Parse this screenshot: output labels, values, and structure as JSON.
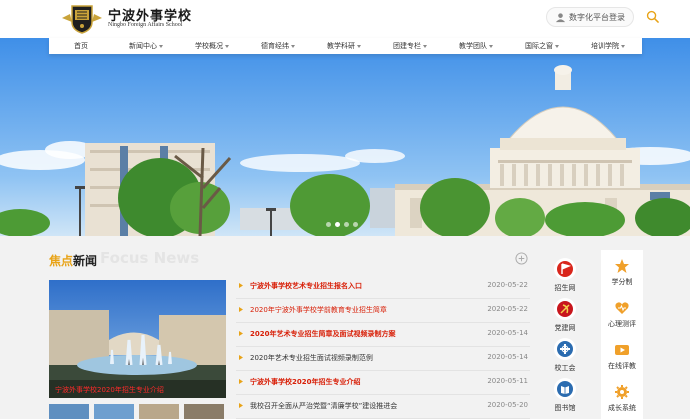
{
  "header": {
    "school_name_cn": "宁波外事学校",
    "school_name_en": "Ningbo Foreign Affairs School",
    "portal_label": "数字化平台登录"
  },
  "nav": {
    "items": [
      {
        "label": "首页",
        "dropdown": false
      },
      {
        "label": "新闻中心",
        "dropdown": true
      },
      {
        "label": "学校概况",
        "dropdown": true
      },
      {
        "label": "德育经纬",
        "dropdown": true
      },
      {
        "label": "教学科研",
        "dropdown": true
      },
      {
        "label": "团建专栏",
        "dropdown": true
      },
      {
        "label": "教学团队",
        "dropdown": true
      },
      {
        "label": "国际之窗",
        "dropdown": true
      },
      {
        "label": "培训学院",
        "dropdown": true
      }
    ]
  },
  "banner": {
    "active_slide": 1,
    "slide_count": 4
  },
  "news": {
    "title_highlight": "焦点",
    "title_rest": "新闻",
    "title_en": "Focus News",
    "feature_caption": "宁波外事学校2020年招生专业介绍",
    "items": [
      {
        "title": "宁波外事学校艺术专业招生报名入口",
        "date": "2020-05-22",
        "color": "#d81e06",
        "bold": true
      },
      {
        "title": "2020年宁波外事学校学前教育专业招生简章",
        "date": "2020-05-22",
        "color": "#d81e06",
        "bold": false
      },
      {
        "title": "2020年艺术专业招生简章及面试视频录制方案",
        "date": "2020-05-14",
        "color": "#d81e06",
        "bold": true
      },
      {
        "title": "2020年艺术专业招生面试视频录制范例",
        "date": "2020-05-14",
        "color": "#333333",
        "bold": false
      },
      {
        "title": "宁波外事学校2020年招生专业介绍",
        "date": "2020-05-11",
        "color": "#d81e06",
        "bold": true
      },
      {
        "title": "我校召开全面从严治党暨“清廉学校”建设推进会",
        "date": "2020-05-20",
        "color": "#333333",
        "bold": false
      }
    ]
  },
  "side_links": [
    {
      "label": "招生网",
      "icon": "flag-icon",
      "color": "#d9261c"
    },
    {
      "label": "党建网",
      "icon": "party-emblem-icon",
      "color": "#c8161d"
    },
    {
      "label": "校工会",
      "icon": "union-icon",
      "color": "#2b6cb0"
    },
    {
      "label": "图书馆",
      "icon": "library-icon",
      "color": "#2b6cb0"
    }
  ],
  "cards": [
    {
      "label": "学分制",
      "icon": "star-icon"
    },
    {
      "label": "心理测评",
      "icon": "heart-icon"
    },
    {
      "label": "在线评教",
      "icon": "video-icon"
    },
    {
      "label": "成长系统",
      "icon": "gear-icon"
    }
  ],
  "colors": {
    "accent": "#e8a317",
    "news_red": "#d81e06",
    "card_orange": "#f0a02a"
  }
}
